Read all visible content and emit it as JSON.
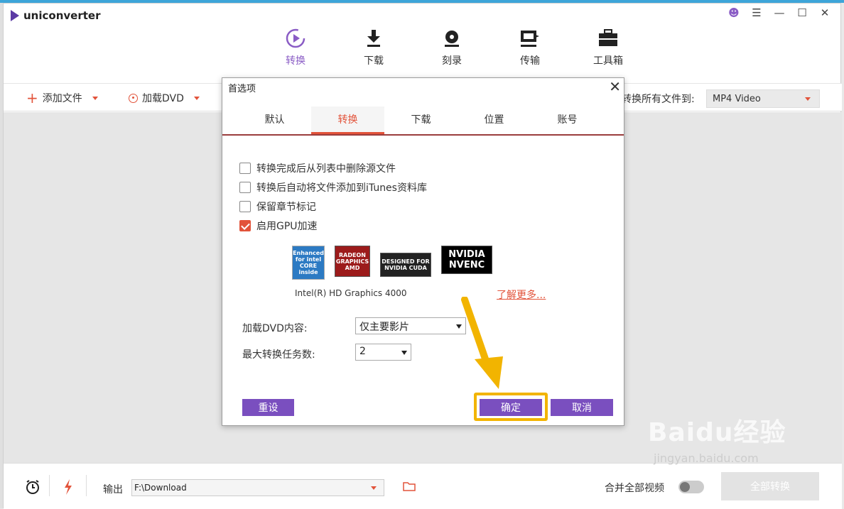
{
  "app": {
    "name": "uniconverter"
  },
  "nav": [
    {
      "label": "转换",
      "icon": "convert-icon",
      "active": true
    },
    {
      "label": "下载",
      "icon": "download-icon"
    },
    {
      "label": "刻录",
      "icon": "burn-icon"
    },
    {
      "label": "传输",
      "icon": "transfer-icon"
    },
    {
      "label": "工具箱",
      "icon": "toolbox-icon"
    }
  ],
  "toolbar": {
    "add_file": "添加文件",
    "load_dvd": "加载DVD",
    "convert_all_to": "转换所有文件到:",
    "format": "MP4 Video"
  },
  "bottom": {
    "output_label": "输出",
    "output_path": "F:\\Download",
    "merge_label": "合并全部视频",
    "convert_all_button": "全部转换"
  },
  "dialog": {
    "title": "首选项",
    "tabs": [
      "默认",
      "转换",
      "下载",
      "位置",
      "账号"
    ],
    "active_tab": "转换",
    "options": [
      {
        "label": "转换完成后从列表中删除源文件",
        "checked": false
      },
      {
        "label": "转换后自动将文件添加到iTunes资料库",
        "checked": false
      },
      {
        "label": "保留章节标记",
        "checked": false
      },
      {
        "label": "启用GPU加速",
        "checked": true
      }
    ],
    "gpu_badges": {
      "intel": "Enhanced for intel CORE inside",
      "radeon": "RADEON GRAPHICS AMD",
      "cuda": "DESIGNED FOR NVIDIA CUDA",
      "nvenc": "NVIDIA NVENC"
    },
    "gpu_name": "Intel(R) HD Graphics 4000",
    "learn_more": "了解更多...",
    "load_dvd_label": "加载DVD内容:",
    "load_dvd_value": "仅主要影片",
    "max_tasks_label": "最大转换任务数:",
    "max_tasks_value": "2",
    "reset_button": "重设",
    "ok_button": "确定",
    "cancel_button": "取消"
  },
  "watermark": {
    "main": "Baidu经验",
    "sub": "jingyan.baidu.com"
  },
  "colors": {
    "accent": "#7a4fbf",
    "highlight": "#e2533a",
    "annotation": "#f2b400"
  }
}
